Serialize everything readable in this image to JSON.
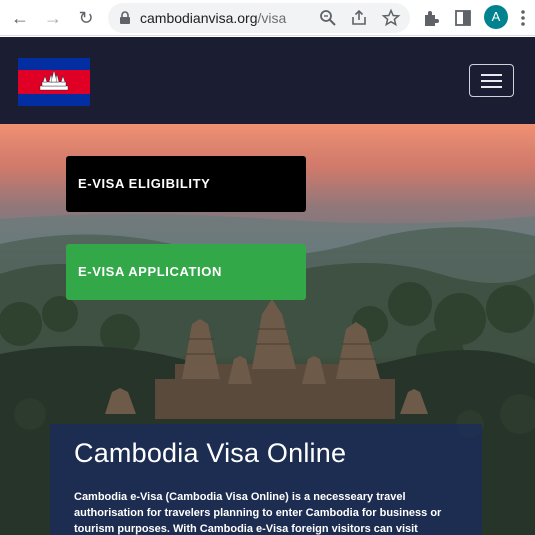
{
  "browser": {
    "url_domain": "cambodianvisa.org",
    "url_path": "/visa",
    "profile_initial": "A",
    "icons": [
      "back-arrow-icon",
      "forward-arrow-icon",
      "reload-icon",
      "lock-icon",
      "zoom-icon",
      "share-icon",
      "bookmark-star-icon",
      "extensions-icon",
      "side-panel-icon",
      "more-menu-icon"
    ]
  },
  "header": {
    "flag_colors": {
      "blue": "#032ea1",
      "red": "#e00025",
      "white": "#ffffff"
    }
  },
  "hero": {
    "cta_eligibility": "E-VISA ELIGIBILITY",
    "cta_application": "E-VISA APPLICATION",
    "card_title": "Cambodia Visa Online",
    "card_text": "Cambodia e-Visa (Cambodia Visa Online) is a necesseary travel authorisation for travelers planning to enter Cambodia for business or tourism purposes. With Cambodia e-Visa foreign visitors can visit Cambodia for upto a month."
  },
  "colors": {
    "header_bg": "#1b1e33",
    "application_button": "#32a848",
    "eligibility_button": "#000000",
    "card_bg": "#1b2b5c"
  }
}
